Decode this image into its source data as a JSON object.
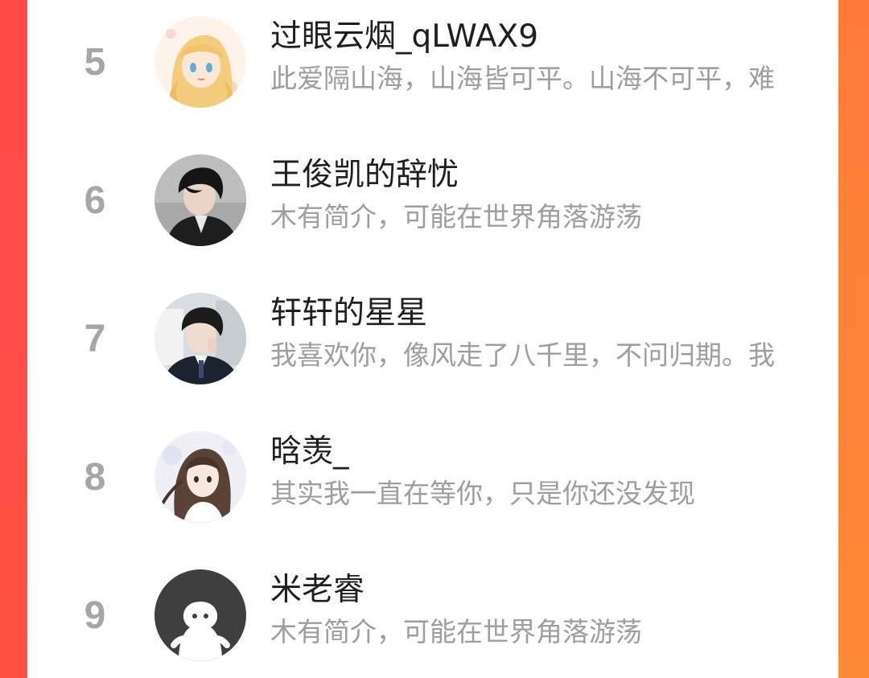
{
  "ranking": {
    "items": [
      {
        "rank": "5",
        "name": "过眼云烟_qLWAX9",
        "bio": "此爱隔山海，山海皆可平。山海不可平，难",
        "avatar_icon": "anime-girl-blonde-avatar-icon"
      },
      {
        "rank": "6",
        "name": "王俊凯的辞忧",
        "bio": "木有简介，可能在世界角落游荡",
        "avatar_icon": "boy-dark-suit-avatar-icon"
      },
      {
        "rank": "7",
        "name": "轩轩的星星",
        "bio": "我喜欢你，像风走了八千里，不问归期。我",
        "avatar_icon": "boy-school-uniform-avatar-icon"
      },
      {
        "rank": "8",
        "name": "晗羡_",
        "bio": "其实我一直在等你，只是你还没发现",
        "avatar_icon": "anime-girl-brown-hair-avatar-icon"
      },
      {
        "rank": "9",
        "name": "米老睿",
        "bio": "木有简介，可能在世界角落游荡",
        "avatar_icon": "default-ghost-avatar-icon"
      }
    ]
  },
  "colors": {
    "frame_left": "#ff4a45",
    "frame_right": "#ff8338",
    "rank": "#a6a6a6",
    "name": "#1f1f1f",
    "bio": "#9e9e9e"
  }
}
